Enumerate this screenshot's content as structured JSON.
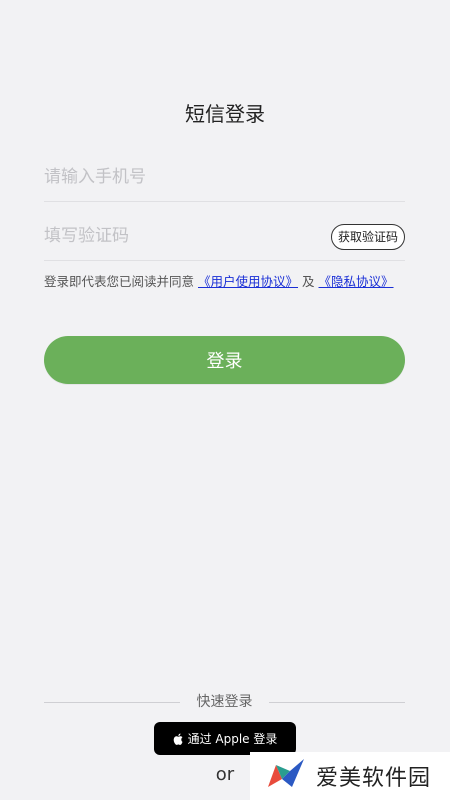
{
  "page": {
    "title": "短信登录"
  },
  "phone": {
    "placeholder": "请输入手机号"
  },
  "code": {
    "placeholder": "填写验证码",
    "get_code_label": "获取验证码"
  },
  "agreement": {
    "prefix": "登录即代表您已阅读并同意",
    "user_agreement": "《用户使用协议》",
    "conjunction": "及",
    "privacy_policy": "《隐私协议》"
  },
  "login_button": {
    "label": "登录"
  },
  "quick_login": {
    "label": "快速登录",
    "apple_label": "通过 Apple 登录"
  },
  "or_text": "or",
  "watermark": {
    "text": "爱美软件园"
  },
  "colors": {
    "accent": "#6bb05a",
    "link": "#1a2fd6",
    "background": "#f2f2f4"
  }
}
